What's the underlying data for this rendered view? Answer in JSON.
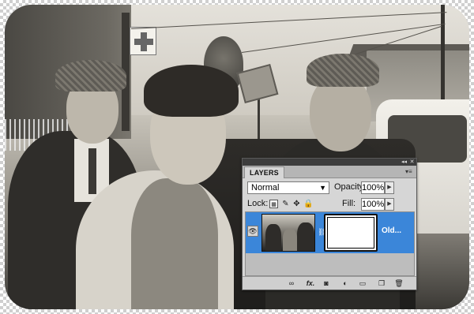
{
  "canvas": {
    "image_description_icon": "photo-canvas"
  },
  "layers_panel": {
    "tab_label": "LAYERS",
    "collapse_glyph": "◂◂",
    "close_glyph": "✕",
    "menu_glyph": "▾≡",
    "blend_mode": "Normal",
    "opacity_label": "Opacity:",
    "opacity_value": "100%",
    "lock_label": "Lock:",
    "fill_label": "Fill:",
    "fill_value": "100%",
    "layers": [
      {
        "name": "Old...",
        "visible": true,
        "selected": true,
        "has_mask": true
      }
    ],
    "bottom_icons": [
      "link-layers-icon",
      "fx-icon",
      "add-mask-icon",
      "adjustment-layer-icon",
      "new-group-icon",
      "new-layer-icon",
      "delete-layer-icon"
    ],
    "fx_text": "fx."
  },
  "colors": {
    "selection_blue": "#3b86d9",
    "panel_bg": "#d6d6d6",
    "titlebar": "#3d3d3d"
  }
}
